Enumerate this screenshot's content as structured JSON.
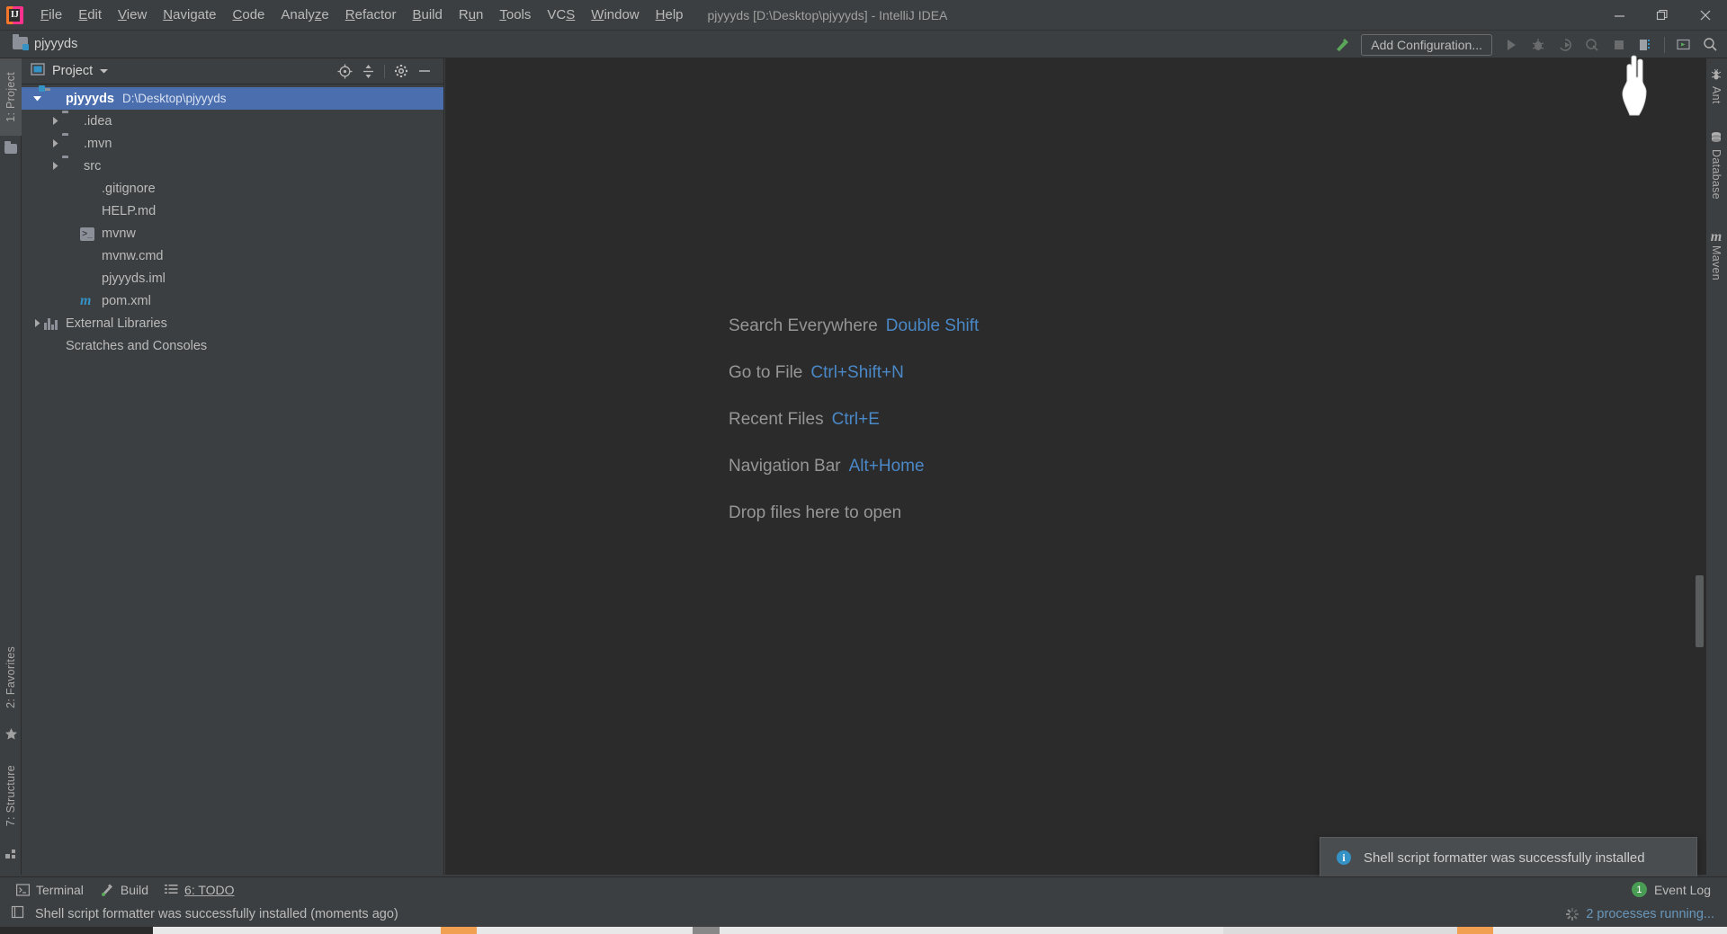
{
  "window": {
    "title": "pjyyyds [D:\\Desktop\\pjyyyds] - IntelliJ IDEA",
    "logo_name": "intellij-idea-logo",
    "minimize_label": "Minimize",
    "maximize_label": "Restore",
    "close_label": "Close"
  },
  "menubar": {
    "items": [
      {
        "label": "File",
        "mnemonic": "F"
      },
      {
        "label": "Edit",
        "mnemonic": "E"
      },
      {
        "label": "View",
        "mnemonic": "V"
      },
      {
        "label": "Navigate",
        "mnemonic": "N"
      },
      {
        "label": "Code",
        "mnemonic": "C"
      },
      {
        "label": "Analyze",
        "mnemonic": "z"
      },
      {
        "label": "Refactor",
        "mnemonic": "R"
      },
      {
        "label": "Build",
        "mnemonic": "B"
      },
      {
        "label": "Run",
        "mnemonic": "u"
      },
      {
        "label": "Tools",
        "mnemonic": "T"
      },
      {
        "label": "VCS",
        "mnemonic": "S"
      },
      {
        "label": "Window",
        "mnemonic": "W"
      },
      {
        "label": "Help",
        "mnemonic": "H"
      }
    ]
  },
  "navbar": {
    "breadcrumb": "pjyyyds",
    "toolbar": {
      "build_hammer": "build-icon",
      "add_configuration_label": "Add Configuration...",
      "run_label": "Run",
      "debug_label": "Debug",
      "run_coverage_label": "Run with Coverage",
      "profile_label": "Profile",
      "stop_label": "Stop",
      "updates_label": "IDE and Plugin Updates",
      "layout_label": "Restore Layout",
      "search_label": "Search"
    }
  },
  "left_stripe": {
    "top_items": [
      {
        "label": "1: Project",
        "icon": "project-folder-icon",
        "active": true
      }
    ],
    "bottom_items": [
      {
        "label": "2: Favorites",
        "icon": "star-icon",
        "active": false
      },
      {
        "label": "7: Structure",
        "icon": "structure-icon",
        "active": false
      }
    ]
  },
  "right_stripe": {
    "items": [
      {
        "label": "Ant",
        "icon": "ant-icon"
      },
      {
        "label": "Database",
        "icon": "database-icon"
      },
      {
        "label": "Maven",
        "icon": "maven-icon"
      }
    ]
  },
  "project_panel": {
    "title": "Project",
    "view_icon": "project-view-icon",
    "dropdown_icon": "chevron-down-icon",
    "actions": [
      {
        "name": "scroll-from-source-icon",
        "label": "Select Opened File"
      },
      {
        "name": "collapse-all-icon",
        "label": "Collapse All"
      },
      {
        "name": "gear-icon",
        "label": "Settings"
      },
      {
        "name": "hide-icon",
        "label": "Hide"
      }
    ],
    "tree": [
      {
        "label": "pjyyyds",
        "sublabel": "D:\\Desktop\\pjyyyds",
        "icon": "module-folder-icon",
        "indent": 0,
        "twisty": "expanded",
        "selected": true,
        "bold": true
      },
      {
        "label": ".idea",
        "sublabel": "",
        "icon": "folder-icon",
        "indent": 1,
        "twisty": "collapsed",
        "selected": false,
        "bold": false
      },
      {
        "label": ".mvn",
        "sublabel": "",
        "icon": "folder-icon",
        "indent": 1,
        "twisty": "collapsed",
        "selected": false,
        "bold": false
      },
      {
        "label": "src",
        "sublabel": "",
        "icon": "folder-icon",
        "indent": 1,
        "twisty": "collapsed",
        "selected": false,
        "bold": false
      },
      {
        "label": ".gitignore",
        "sublabel": "",
        "icon": "gitignore-file-icon",
        "indent": 2,
        "twisty": "none",
        "selected": false,
        "bold": false
      },
      {
        "label": "HELP.md",
        "sublabel": "",
        "icon": "markdown-file-icon",
        "indent": 2,
        "twisty": "none",
        "selected": false,
        "bold": false
      },
      {
        "label": "mvnw",
        "sublabel": "",
        "icon": "shell-script-icon",
        "indent": 2,
        "twisty": "none",
        "selected": false,
        "bold": false
      },
      {
        "label": "mvnw.cmd",
        "sublabel": "",
        "icon": "cmd-file-icon",
        "indent": 2,
        "twisty": "none",
        "selected": false,
        "bold": false
      },
      {
        "label": "pjyyyds.iml",
        "sublabel": "",
        "icon": "iml-file-icon",
        "indent": 2,
        "twisty": "none",
        "selected": false,
        "bold": false
      },
      {
        "label": "pom.xml",
        "sublabel": "",
        "icon": "maven-pom-icon",
        "indent": 2,
        "twisty": "none",
        "selected": false,
        "bold": false
      },
      {
        "label": "External Libraries",
        "sublabel": "",
        "icon": "libraries-icon",
        "indent": 0,
        "twisty": "collapsed",
        "selected": false,
        "bold": false
      },
      {
        "label": "Scratches and Consoles",
        "sublabel": "",
        "icon": "scratches-icon",
        "indent": 0,
        "twisty": "none",
        "selected": false,
        "bold": false
      }
    ]
  },
  "editor": {
    "welcome_rows": [
      {
        "name": "Search Everywhere",
        "key": "Double Shift"
      },
      {
        "name": "Go to File",
        "key": "Ctrl+Shift+N"
      },
      {
        "name": "Recent Files",
        "key": "Ctrl+E"
      },
      {
        "name": "Navigation Bar",
        "key": "Alt+Home"
      }
    ],
    "drop_hint": "Drop files here to open"
  },
  "notification": {
    "icon": "info-icon",
    "text": "Shell script formatter was successfully installed"
  },
  "bottom_bar": {
    "items": [
      {
        "label": "Terminal",
        "icon": "terminal-icon"
      },
      {
        "label": "Build",
        "icon": "build-hammer-icon"
      },
      {
        "label": "6: TODO",
        "icon": "todo-list-icon",
        "mnemonic": "6"
      }
    ],
    "event_log": {
      "count": "1",
      "label": "Event Log"
    }
  },
  "status_bar": {
    "icon": "memory-indicator-icon",
    "message": "Shell script formatter was successfully installed (moments ago)",
    "processes": "2 processes running...",
    "spinner_icon": "loading-spinner-icon"
  },
  "colors": {
    "accent_blue": "#4b6eaf",
    "link_blue": "#4a88c7",
    "panel_bg": "#3c3f41",
    "editor_bg": "#2b2b2b",
    "green_badge": "#499c54",
    "info_blue": "#3592c4"
  }
}
